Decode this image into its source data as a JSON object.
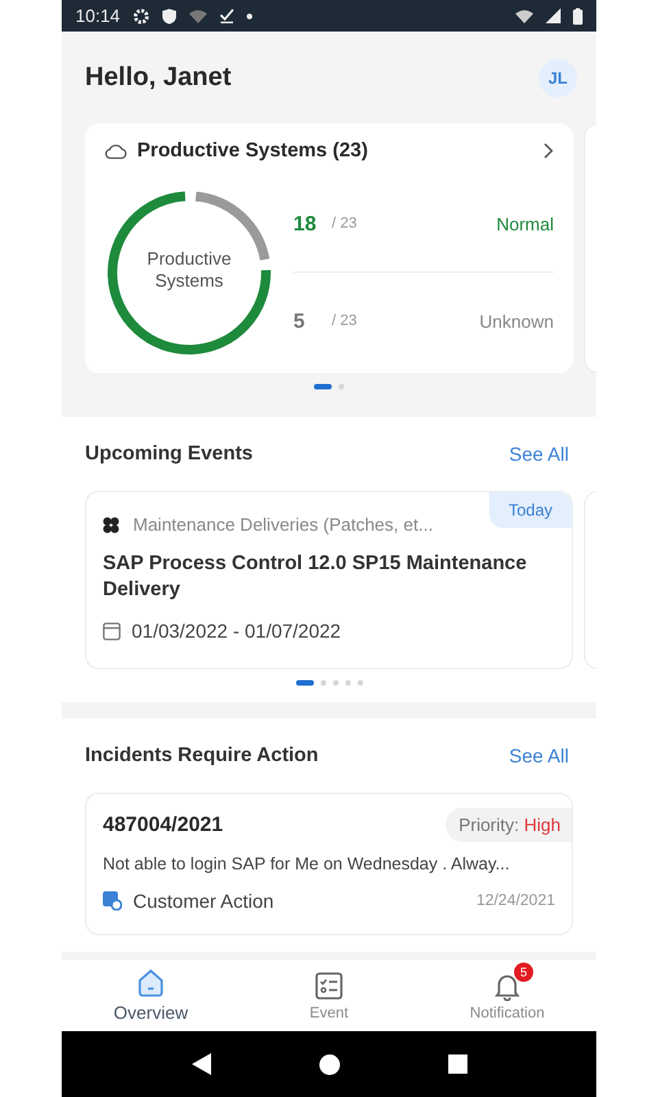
{
  "status_bar": {
    "time": "10:14"
  },
  "header": {
    "greeting": "Hello, Janet",
    "avatar": "JL"
  },
  "systems_card": {
    "title": "Productive Systems (23)",
    "ring": {
      "label": "Productive Systems"
    },
    "stats": [
      {
        "count": "18",
        "total": "/ 23",
        "status": "Normal",
        "kind": "normal"
      },
      {
        "count": "5",
        "total": "/ 23",
        "status": "Unknown",
        "kind": "unknown"
      }
    ],
    "pager": [
      {
        "selected": true
      },
      {
        "selected": false
      }
    ]
  },
  "events": {
    "title": "Upcoming Events",
    "see_all": "See All",
    "card": {
      "category": "Maintenance Deliveries (Patches, et...",
      "badge": "Today",
      "title": "SAP Process Control 12.0 SP15 Maintenance Delivery",
      "dates": "01/03/2022 - 01/07/2022"
    },
    "pager": [
      {
        "selected": true
      },
      {
        "selected": false
      },
      {
        "selected": false
      },
      {
        "selected": false
      },
      {
        "selected": false
      }
    ]
  },
  "incidents": {
    "title": "Incidents Require Action",
    "see_all": "See All",
    "card": {
      "id": "487004/2021",
      "priority_label": "Priority:",
      "priority": "High",
      "description": "Not able to login SAP for Me on Wednesday . Alway...",
      "status": "Customer Action",
      "date": "12/24/2021"
    }
  },
  "tabs": [
    {
      "label": "Overview",
      "selected": true,
      "kind": "home"
    },
    {
      "label": "Event",
      "selected": false,
      "kind": "list"
    },
    {
      "label": "Notification",
      "selected": false,
      "kind": "bell",
      "badge": "5"
    }
  ]
}
